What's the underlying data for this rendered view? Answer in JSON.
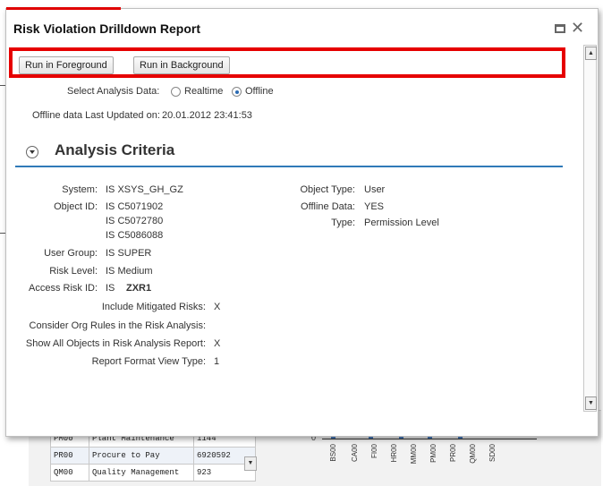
{
  "dialog": {
    "title": "Risk Violation Drilldown Report",
    "buttons": {
      "run_foreground": "Run in Foreground",
      "run_background": "Run in Background"
    }
  },
  "analysis": {
    "select_label": "Select Analysis Data:",
    "realtime_label": "Realtime",
    "offline_label": "Offline",
    "selected": "Offline",
    "updated_label": "Offline data Last Updated on:",
    "updated_value": "20.01.2012 23:41:53"
  },
  "criteria": {
    "title": "Analysis Criteria",
    "system_label": "System:",
    "system_value": "IS XSYS_GH_GZ",
    "object_id_label": "Object ID:",
    "object_ids": [
      "IS  C5071902",
      "IS  C5072780",
      "IS  C5086088"
    ],
    "user_group_label": "User Group:",
    "user_group_value": "IS   SUPER",
    "risk_level_label": "Risk Level:",
    "risk_level_value": "IS   Medium",
    "access_risk_label": "Access Risk ID:",
    "access_risk_is": "IS",
    "access_risk_value": "ZXR1",
    "object_type_label": "Object Type:",
    "object_type_value": "User",
    "offline_data_label": "Offline Data:",
    "offline_data_value": "YES",
    "type_label": "Type:",
    "type_value": "Permission Level",
    "mitigated_label": "Include Mitigated Risks:",
    "mitigated_value": "X",
    "org_rules_label": "Consider Org Rules in the Risk Analysis:",
    "org_rules_value": "",
    "show_all_label": "Show All Objects in Risk Analysis Report:",
    "show_all_value": "X",
    "format_label": "Report Format View Type:",
    "format_value": "1"
  },
  "background": {
    "rows": [
      {
        "code": "PM00",
        "name": "Plant Maintenance",
        "value": "1144"
      },
      {
        "code": "PR00",
        "name": "Procure to Pay",
        "value": "6920592"
      },
      {
        "code": "QM00",
        "name": "Quality Management",
        "value": "923"
      }
    ],
    "chart_zero": "0",
    "chart_labels": [
      "BS00",
      "CA00",
      "FI00",
      "HR00",
      "MM00",
      "PM00",
      "PR00",
      "QM00",
      "SD00"
    ]
  },
  "colors": {
    "highlight": "#e60000",
    "accent": "#2f7ab8"
  }
}
